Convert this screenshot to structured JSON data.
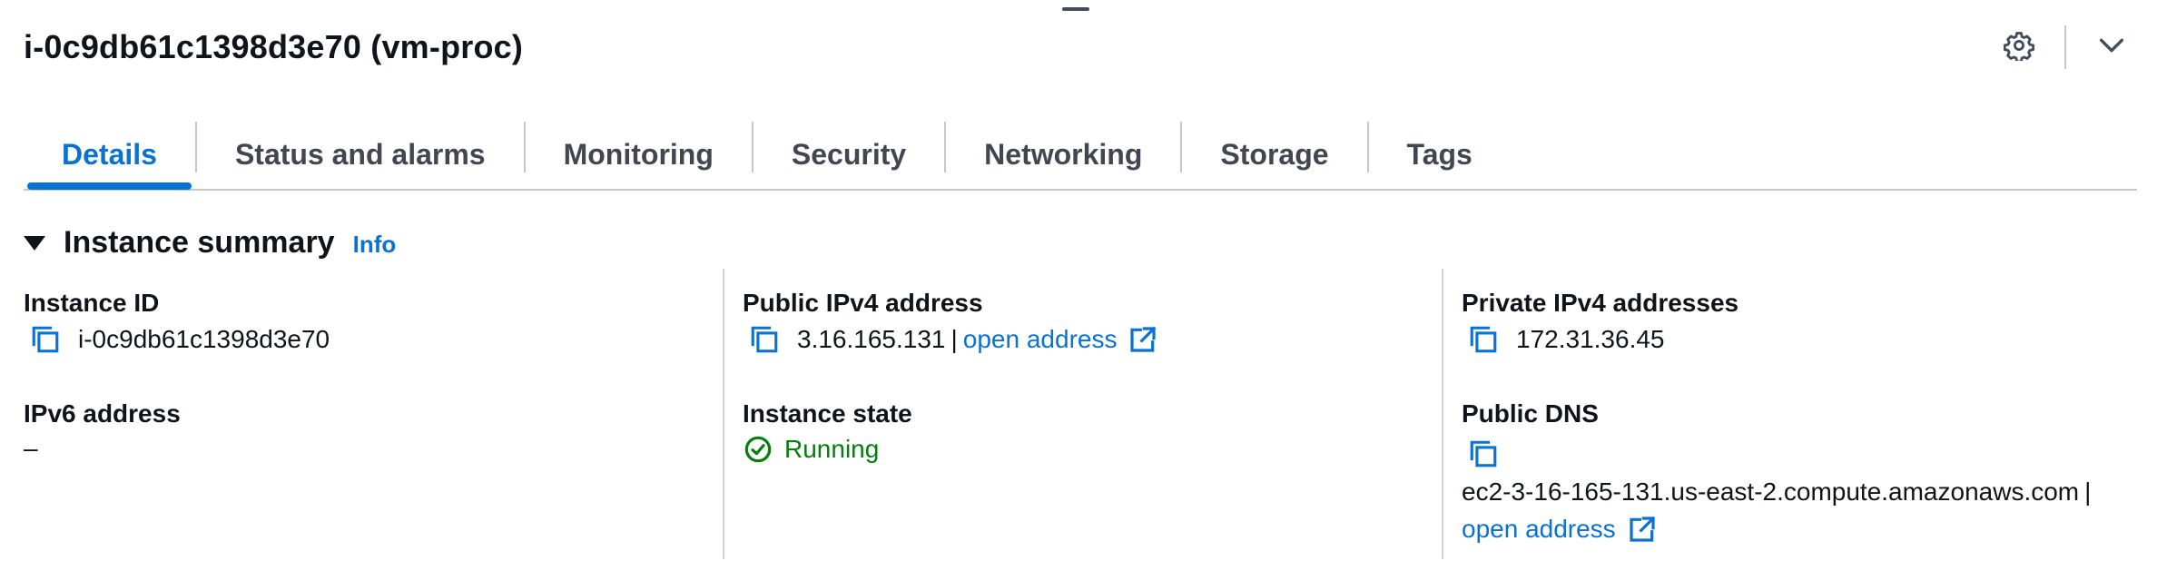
{
  "header": {
    "title": "i-0c9db61c1398d3e70 (vm-proc)",
    "settings_icon": "gear-icon",
    "collapse_icon": "chevron-down-icon"
  },
  "tabs": [
    {
      "label": "Details",
      "active": true
    },
    {
      "label": "Status and alarms",
      "active": false
    },
    {
      "label": "Monitoring",
      "active": false
    },
    {
      "label": "Security",
      "active": false
    },
    {
      "label": "Networking",
      "active": false
    },
    {
      "label": "Storage",
      "active": false
    },
    {
      "label": "Tags",
      "active": false
    }
  ],
  "summary": {
    "title": "Instance summary",
    "info_link": "Info",
    "instance_id": {
      "label": "Instance ID",
      "value": "i-0c9db61c1398d3e70"
    },
    "ipv6": {
      "label": "IPv6 address",
      "value": "–"
    },
    "public_ipv4": {
      "label": "Public IPv4 address",
      "value": "3.16.165.131",
      "separator": "|",
      "link": "open address"
    },
    "instance_state": {
      "label": "Instance state",
      "value": "Running"
    },
    "private_ipv4": {
      "label": "Private IPv4 addresses",
      "value": "172.31.36.45"
    },
    "public_dns": {
      "label": "Public DNS",
      "value": "ec2-3-16-165-131.us-east-2.compute.amazonaws.com",
      "separator": "|",
      "link": "open address"
    }
  },
  "colors": {
    "accent": "#0972d3",
    "success": "#037f0c",
    "text": "#0f141a",
    "tab_text": "#424650",
    "divider": "#c6c6cd"
  }
}
